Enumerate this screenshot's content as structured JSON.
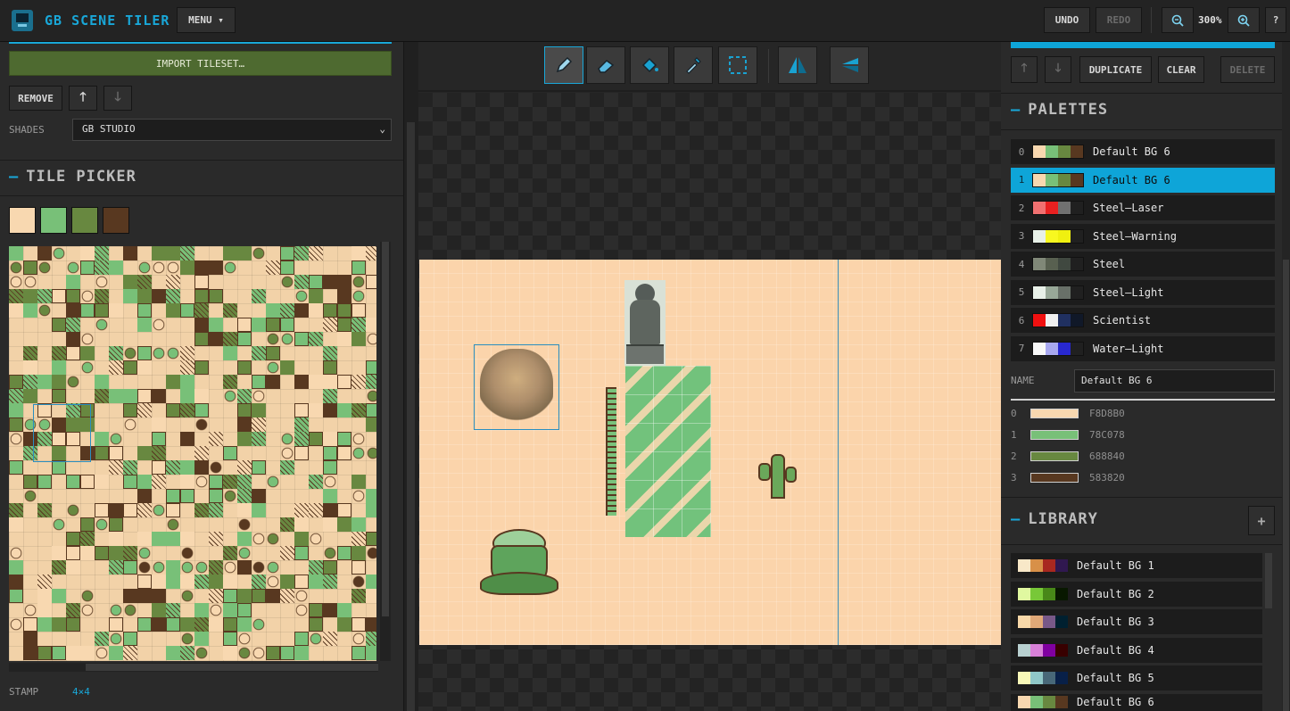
{
  "app": {
    "title": "GB SCENE TILER",
    "menu_label": "MENU ▾"
  },
  "toolbar_right": {
    "undo": "UNDO",
    "redo": "REDO",
    "zoom": "300%",
    "zoom_out_icon": "zoom-out-icon",
    "zoom_in_icon": "zoom-in-icon",
    "help": "?"
  },
  "left_panel": {
    "import_button": "IMPORT TILESET…",
    "remove_button": "REMOVE",
    "shades_label": "SHADES",
    "shades_value": "GB STUDIO",
    "tile_picker_title": "TILE PICKER",
    "picker_colors": [
      "#f8d8b0",
      "#78c078",
      "#688840",
      "#583820"
    ],
    "stamp_label": "STAMP",
    "stamp_value": "4×4"
  },
  "tools": [
    {
      "name": "pencil-tool",
      "icon": "pencil-icon",
      "active": true
    },
    {
      "name": "eraser-tool",
      "icon": "eraser-icon"
    },
    {
      "name": "fill-tool",
      "icon": "fill-bucket-icon"
    },
    {
      "name": "eyedropper-tool",
      "icon": "eyedropper-icon"
    },
    {
      "name": "select-tool",
      "icon": "marquee-select-icon"
    },
    {
      "name": "flip-horizontal-tool",
      "icon": "flip-horizontal-icon"
    },
    {
      "name": "flip-vertical-tool",
      "icon": "flip-vertical-icon"
    }
  ],
  "right_panel": {
    "duplicate_button": "DUPLICATE",
    "clear_button": "CLEAR",
    "delete_button": "DELETE",
    "palettes_title": "PALETTES",
    "palettes": [
      {
        "index": "0",
        "name": "Default BG 6",
        "colors": [
          "#f8d8b0",
          "#78c078",
          "#688840",
          "#583820"
        ]
      },
      {
        "index": "1",
        "name": "Default BG 6",
        "colors": [
          "#f8d8b0",
          "#78c078",
          "#688840",
          "#583820"
        ],
        "selected": true
      },
      {
        "index": "2",
        "name": "Steel–Laser",
        "colors": [
          "#f07070",
          "#e82020",
          "#707070",
          "#202020"
        ]
      },
      {
        "index": "3",
        "name": "Steel–Warning",
        "colors": [
          "#e8f0e8",
          "#f8f820",
          "#f0f010",
          "#202020"
        ]
      },
      {
        "index": "4",
        "name": "Steel",
        "colors": [
          "#808878",
          "#586050",
          "#404840",
          "#202020"
        ]
      },
      {
        "index": "5",
        "name": "Steel–Light",
        "colors": [
          "#e8f0e8",
          "#98a898",
          "#687068",
          "#202020"
        ]
      },
      {
        "index": "6",
        "name": "Scientist",
        "colors": [
          "#f01010",
          "#f0f0f0",
          "#203060",
          "#101828"
        ]
      },
      {
        "index": "7",
        "name": "Water–Light",
        "colors": [
          "#f8f8f8",
          "#a8a8f0",
          "#2828d0",
          "#202020"
        ]
      }
    ],
    "name_label": "NAME",
    "name_value": "Default BG 6",
    "color_entries": [
      {
        "index": "0",
        "hex": "F8D8B0",
        "color": "#f8d8b0"
      },
      {
        "index": "1",
        "hex": "78C078",
        "color": "#78c078"
      },
      {
        "index": "2",
        "hex": "688840",
        "color": "#688840"
      },
      {
        "index": "3",
        "hex": "583820",
        "color": "#583820"
      }
    ],
    "library_title": "LIBRARY",
    "library_add": "+",
    "library": [
      {
        "name": "Default BG 1",
        "colors": [
          "#f8e8c8",
          "#d89048",
          "#a82820",
          "#301850"
        ]
      },
      {
        "name": "Default BG 2",
        "colors": [
          "#e0f8a0",
          "#78c838",
          "#488818",
          "#081800"
        ]
      },
      {
        "name": "Default BG 3",
        "colors": [
          "#f8d8a8",
          "#e0a878",
          "#785888",
          "#002030"
        ]
      },
      {
        "name": "Default BG 4",
        "colors": [
          "#b8d0d0",
          "#d880d8",
          "#8000a0",
          "#380000"
        ]
      },
      {
        "name": "Default BG 5",
        "colors": [
          "#f8f8b8",
          "#90c8c8",
          "#486878",
          "#082048"
        ]
      },
      {
        "name": "Default BG 6",
        "colors": [
          "#f8d8b0",
          "#78c078",
          "#688840",
          "#583820"
        ]
      }
    ]
  }
}
